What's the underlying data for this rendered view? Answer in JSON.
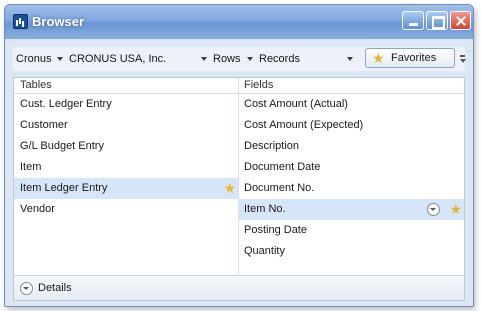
{
  "window": {
    "title": "Browser"
  },
  "toolbar": {
    "breadcrumb": [
      "Cronus",
      "CRONUS USA, Inc.",
      "Rows",
      "Records"
    ],
    "favorites_label": "Favorites"
  },
  "tables": {
    "header": "Tables",
    "items": [
      "Cust. Ledger Entry",
      "Customer",
      "G/L Budget Entry",
      "Item",
      "Item Ledger Entry",
      "Vendor"
    ],
    "selected": "Item Ledger Entry"
  },
  "fields": {
    "header": "Fields",
    "items": [
      "Cost Amount (Actual)",
      "Cost Amount (Expected)",
      "Description",
      "Document Date",
      "Document No.",
      "Item No.",
      "Posting Date",
      "Quantity"
    ],
    "selected": "Item No."
  },
  "details": {
    "label": "Details"
  },
  "colors": {
    "titlebar": "#7ea8df",
    "selection": "#d6e5f7",
    "star": "#e8b530",
    "close": "#d5452f"
  },
  "icons": [
    "app-icon",
    "minimize-icon",
    "maximize-icon",
    "close-icon",
    "star-icon",
    "chevron-down-icon",
    "overflow-icon"
  ]
}
